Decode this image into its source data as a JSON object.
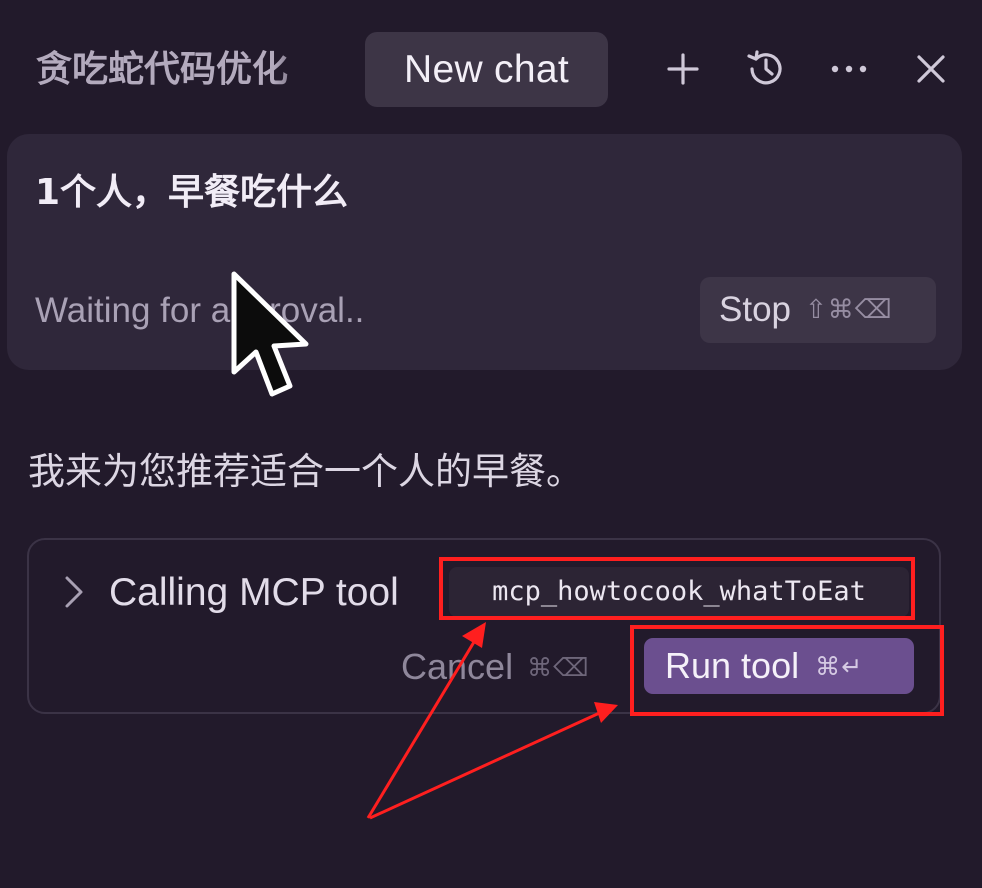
{
  "header": {
    "chat_title": "贪吃蛇代码优化",
    "new_chat_tab": "New chat",
    "icons": [
      "plus-icon",
      "history-icon",
      "more-icon",
      "close-icon"
    ]
  },
  "user_message": {
    "text": "1个人，早餐吃什么",
    "status": "Waiting for approval..",
    "stop_button": {
      "label": "Stop",
      "shortcut": "⇧⌘⌫"
    }
  },
  "assistant_message": {
    "text": "我来为您推荐适合一个人的早餐。"
  },
  "tool_call": {
    "label": "Calling MCP tool",
    "tool_name": "mcp_howtocook_whatToEat",
    "cancel_button": {
      "label": "Cancel",
      "shortcut": "⌘⌫"
    },
    "run_button": {
      "label": "Run tool",
      "shortcut": "⌘↵"
    }
  },
  "colors": {
    "background": "#221a2b",
    "card": "#2f273a",
    "accent_button": "#6b4f8f",
    "annotation": "#ff1f1f"
  }
}
